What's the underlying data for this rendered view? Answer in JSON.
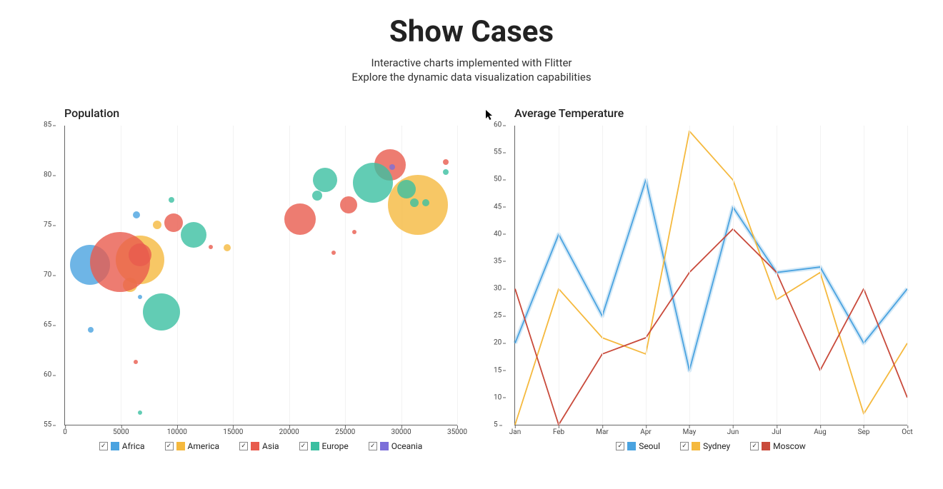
{
  "header": {
    "title": "Show Cases",
    "subtitle1": "Interactive charts implemented with Flitter",
    "subtitle2": "Explore the dynamic data visualization capabilities"
  },
  "colors": {
    "africa": "#4aa3e0",
    "america": "#f5b93e",
    "asia": "#e85b4d",
    "europe": "#3bbfa1",
    "oceania": "#7c6fd9",
    "seoul": "#4aa3e0",
    "sydney": "#f5b93e",
    "moscow": "#c94a3b"
  },
  "population_chart": {
    "title": "Population",
    "x_range": [
      0,
      35000
    ],
    "y_range": [
      55,
      85
    ],
    "x_ticks": [
      0,
      5000,
      10000,
      15000,
      20000,
      25000,
      30000,
      35000
    ],
    "y_ticks": [
      55,
      60,
      65,
      70,
      75,
      80,
      85
    ],
    "legend": [
      "Africa",
      "America",
      "Asia",
      "Europe",
      "Oceania"
    ]
  },
  "temperature_chart": {
    "title": "Average Temperature",
    "x_categories": [
      "Jan",
      "Feb",
      "Mar",
      "Apr",
      "May",
      "Jun",
      "Jul",
      "Aug",
      "Sep",
      "Oct"
    ],
    "y_range": [
      5,
      60
    ],
    "y_ticks": [
      5,
      10,
      15,
      20,
      25,
      30,
      35,
      40,
      45,
      50,
      55,
      60
    ],
    "legend": [
      "Seoul",
      "Sydney",
      "Moscow"
    ]
  },
  "chart_data": [
    {
      "type": "scatter",
      "title": "Population",
      "xlabel": "",
      "ylabel": "",
      "xlim": [
        0,
        35000
      ],
      "ylim": [
        55,
        85
      ],
      "series": [
        {
          "name": "Africa",
          "color": "#4aa3e0",
          "points": [
            {
              "x": 2200,
              "y": 71,
              "r": 28
            },
            {
              "x": 2300,
              "y": 64.5,
              "r": 4
            },
            {
              "x": 6400,
              "y": 76,
              "r": 5
            },
            {
              "x": 6700,
              "y": 67.8,
              "r": 3
            }
          ]
        },
        {
          "name": "America",
          "color": "#f5b93e",
          "points": [
            {
              "x": 6700,
              "y": 71.5,
              "r": 34
            },
            {
              "x": 5800,
              "y": 69,
              "r": 10
            },
            {
              "x": 8200,
              "y": 75,
              "r": 6
            },
            {
              "x": 31500,
              "y": 77,
              "r": 42
            },
            {
              "x": 14500,
              "y": 72.7,
              "r": 5
            }
          ]
        },
        {
          "name": "Asia",
          "color": "#e85b4d",
          "points": [
            {
              "x": 4900,
              "y": 71.3,
              "r": 42
            },
            {
              "x": 6700,
              "y": 72,
              "r": 16
            },
            {
              "x": 9700,
              "y": 75.2,
              "r": 13
            },
            {
              "x": 21000,
              "y": 75.6,
              "r": 22
            },
            {
              "x": 25300,
              "y": 77,
              "r": 12
            },
            {
              "x": 29000,
              "y": 81,
              "r": 22
            },
            {
              "x": 34000,
              "y": 81.3,
              "r": 4
            },
            {
              "x": 6300,
              "y": 61.3,
              "r": 3
            },
            {
              "x": 13000,
              "y": 72.8,
              "r": 3
            },
            {
              "x": 25800,
              "y": 74.3,
              "r": 3
            },
            {
              "x": 24000,
              "y": 72.2,
              "r": 3
            }
          ]
        },
        {
          "name": "Europe",
          "color": "#3bbfa1",
          "points": [
            {
              "x": 8600,
              "y": 66.3,
              "r": 26
            },
            {
              "x": 11500,
              "y": 74,
              "r": 18
            },
            {
              "x": 23200,
              "y": 79.5,
              "r": 17
            },
            {
              "x": 27500,
              "y": 79.2,
              "r": 28
            },
            {
              "x": 22500,
              "y": 77.9,
              "r": 7
            },
            {
              "x": 30500,
              "y": 78.6,
              "r": 13
            },
            {
              "x": 31200,
              "y": 77.2,
              "r": 6
            },
            {
              "x": 32200,
              "y": 77.2,
              "r": 5
            },
            {
              "x": 34000,
              "y": 80.3,
              "r": 4
            },
            {
              "x": 9500,
              "y": 77.5,
              "r": 4
            },
            {
              "x": 6700,
              "y": 56.2,
              "r": 3
            }
          ]
        },
        {
          "name": "Oceania",
          "color": "#7c6fd9",
          "points": [
            {
              "x": 29200,
              "y": 80.8,
              "r": 4
            }
          ]
        }
      ]
    },
    {
      "type": "line",
      "title": "Average Temperature",
      "xlabel": "",
      "ylabel": "",
      "categories": [
        "Jan",
        "Feb",
        "Mar",
        "Apr",
        "May",
        "Jun",
        "Jul",
        "Aug",
        "Sep",
        "Oct"
      ],
      "ylim": [
        5,
        60
      ],
      "series": [
        {
          "name": "Seoul",
          "color": "#4aa3e0",
          "values": [
            20,
            40,
            25,
            50,
            15,
            45,
            33,
            34,
            20,
            30
          ]
        },
        {
          "name": "Sydney",
          "color": "#f5b93e",
          "values": [
            5,
            30,
            21,
            18,
            59,
            50,
            28,
            33,
            7,
            20
          ]
        },
        {
          "name": "Moscow",
          "color": "#c94a3b",
          "values": [
            30,
            5,
            18,
            21,
            33,
            41,
            33,
            15,
            30,
            10
          ]
        }
      ]
    }
  ]
}
